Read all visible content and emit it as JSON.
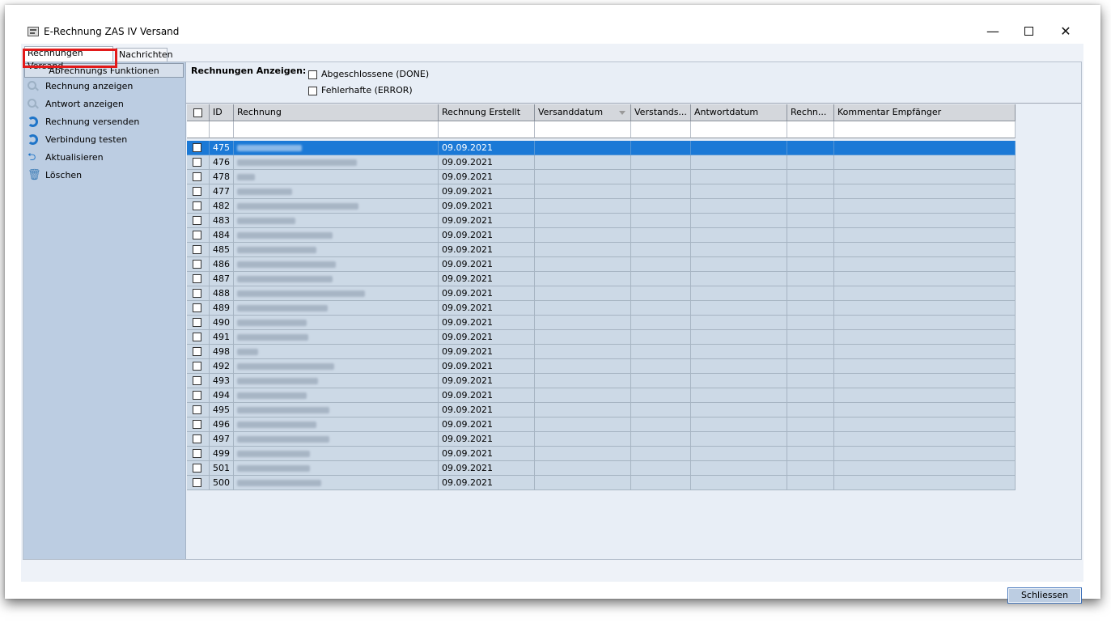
{
  "window": {
    "title": "E-Rechnung ZAS IV Versand",
    "minimize": "—",
    "close": "✕"
  },
  "tabs": [
    "Rechnungen Versand",
    "Nachrichten"
  ],
  "sidebar": {
    "header": "Abrechnungs Funktionen",
    "items": [
      {
        "label": "Rechnung anzeigen",
        "icon": "magnifier-icon"
      },
      {
        "label": "Antwort anzeigen",
        "icon": "magnifier-icon"
      },
      {
        "label": "Rechnung versenden",
        "icon": "sync-icon"
      },
      {
        "label": "Verbindung testen",
        "icon": "sync-icon"
      },
      {
        "label": "Aktualisieren",
        "icon": "refresh-icon"
      },
      {
        "label": "Löschen",
        "icon": "trash-icon"
      }
    ]
  },
  "filter": {
    "label": "Rechnungen Anzeigen:",
    "options": [
      "Abgeschlossene (DONE)",
      "Fehlerhafte (ERROR)"
    ]
  },
  "grid": {
    "columns": [
      "ID",
      "Rechnung",
      "Rechnung Erstellt",
      "Versanddatum",
      "Verstands...",
      "Antwortdatum",
      "Rechn...",
      "Kommentar Empfänger"
    ],
    "rows": [
      {
        "id": "475",
        "erstellt": "09.09.2021",
        "selected": true
      },
      {
        "id": "476",
        "erstellt": "09.09.2021"
      },
      {
        "id": "478",
        "erstellt": "09.09.2021"
      },
      {
        "id": "477",
        "erstellt": "09.09.2021"
      },
      {
        "id": "482",
        "erstellt": "09.09.2021"
      },
      {
        "id": "483",
        "erstellt": "09.09.2021"
      },
      {
        "id": "484",
        "erstellt": "09.09.2021"
      },
      {
        "id": "485",
        "erstellt": "09.09.2021"
      },
      {
        "id": "486",
        "erstellt": "09.09.2021"
      },
      {
        "id": "487",
        "erstellt": "09.09.2021"
      },
      {
        "id": "488",
        "erstellt": "09.09.2021"
      },
      {
        "id": "489",
        "erstellt": "09.09.2021"
      },
      {
        "id": "490",
        "erstellt": "09.09.2021"
      },
      {
        "id": "491",
        "erstellt": "09.09.2021"
      },
      {
        "id": "498",
        "erstellt": "09.09.2021"
      },
      {
        "id": "492",
        "erstellt": "09.09.2021"
      },
      {
        "id": "493",
        "erstellt": "09.09.2021"
      },
      {
        "id": "494",
        "erstellt": "09.09.2021"
      },
      {
        "id": "495",
        "erstellt": "09.09.2021"
      },
      {
        "id": "496",
        "erstellt": "09.09.2021"
      },
      {
        "id": "497",
        "erstellt": "09.09.2021"
      },
      {
        "id": "499",
        "erstellt": "09.09.2021"
      },
      {
        "id": "501",
        "erstellt": "09.09.2021"
      },
      {
        "id": "500",
        "erstellt": "09.09.2021"
      }
    ]
  },
  "footer": {
    "close_label": "Schliessen"
  }
}
